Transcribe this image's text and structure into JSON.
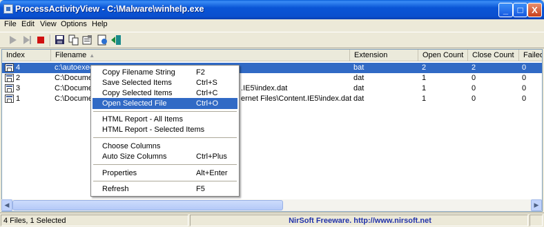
{
  "window": {
    "title": "ProcessActivityView  -  C:\\Malware\\winhelp.exe",
    "minimize": "_",
    "maximize": "□",
    "close": "X"
  },
  "menu": [
    "File",
    "Edit",
    "View",
    "Options",
    "Help"
  ],
  "toolbar": {
    "buttons": [
      "play-icon",
      "play-step-icon",
      "stop-icon",
      "save-icon",
      "copy-icon",
      "properties-icon",
      "html-report-icon",
      "exit-icon"
    ]
  },
  "columns": [
    "Index",
    "Filename",
    "Extension",
    "Open Count",
    "Close Count",
    "Failed"
  ],
  "rows": [
    {
      "index": "4",
      "filename": "c:\\autoexec",
      "extension": "bat",
      "open": "2",
      "close": "2",
      "failed": "0"
    },
    {
      "index": "2",
      "filename": "C:\\Documen",
      "extension": "dat",
      "open": "1",
      "close": "0",
      "failed": "0"
    },
    {
      "index": "3",
      "filename": "C:\\Documen",
      "filename_tail": ".IE5\\index.dat",
      "extension": "dat",
      "open": "1",
      "close": "0",
      "failed": "0"
    },
    {
      "index": "1",
      "filename": "C:\\Documen",
      "filename_tail": "ernet Files\\Content.IE5\\index.dat",
      "extension": "dat",
      "open": "1",
      "close": "0",
      "failed": "0"
    }
  ],
  "context_menu": [
    {
      "label": "Copy Filename String",
      "key": "F2"
    },
    {
      "label": "Save Selected Items",
      "key": "Ctrl+S"
    },
    {
      "label": "Copy Selected Items",
      "key": "Ctrl+C"
    },
    {
      "label": "Open Selected File",
      "key": "Ctrl+O"
    },
    {
      "label": "HTML Report - All Items",
      "key": ""
    },
    {
      "label": "HTML Report - Selected Items",
      "key": ""
    },
    {
      "label": "Choose Columns",
      "key": ""
    },
    {
      "label": "Auto Size Columns",
      "key": "Ctrl+Plus"
    },
    {
      "label": "Properties",
      "key": "Alt+Enter"
    },
    {
      "label": "Refresh",
      "key": "F5"
    }
  ],
  "status": {
    "count": "4 Files, 1 Selected",
    "link": "NirSoft Freeware.  http://www.nirsoft.net"
  },
  "colors": {
    "selection": "#316ac5",
    "titlebar": "#0a55d6",
    "link": "#2233aa"
  }
}
